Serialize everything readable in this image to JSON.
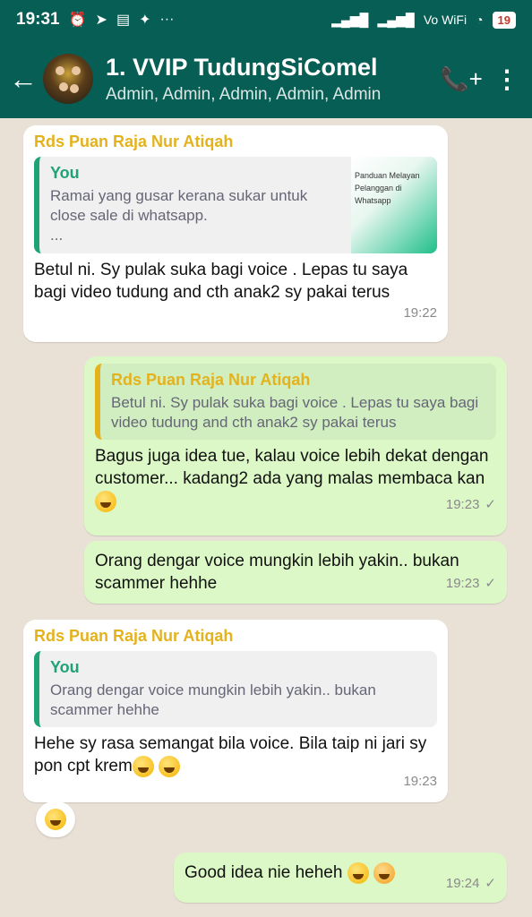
{
  "status": {
    "time": "19:31",
    "battery": "19",
    "net_label": "Vo WiFi",
    "left_icons": [
      "alarm-icon",
      "telegram-icon",
      "news-icon",
      "twitter-icon"
    ],
    "more": "···"
  },
  "header": {
    "back_icon": "←",
    "title": "1. VVIP TudungSiComel",
    "subtitle": "Admin, Admin, Admin, Admin, Admin",
    "call_icon": "📞+",
    "menu_icon": "⋮"
  },
  "messages": [
    {
      "sender": "Rds Puan Raja Nur Atiqah",
      "quote_name": "You",
      "quote_text": "Ramai yang gusar kerana sukar untuk close sale di whatsapp.",
      "quote_more": "...",
      "thumb_text": "Panduan Melayan Pelanggan di Whatsapp",
      "text": "Betul ni. Sy pulak suka bagi voice . Lepas tu saya bagi video tudung and cth anak2 sy pakai terus",
      "time": "19:22"
    },
    {
      "quote_name": "Rds Puan Raja Nur Atiqah",
      "quote_text": "Betul ni. Sy pulak suka bagi voice . Lepas tu saya bagi video tudung and cth anak2 sy pakai terus",
      "text": "Bagus juga idea tue, kalau voice lebih dekat dengan customer... kadang2 ada yang malas membaca kan",
      "time": "19:23"
    },
    {
      "text": "Orang dengar voice mungkin lebih yakin.. bukan scammer hehhe",
      "time": "19:23"
    },
    {
      "sender": "Rds Puan Raja Nur Atiqah",
      "quote_name": "You",
      "quote_text": "Orang dengar voice mungkin lebih yakin.. bukan scammer hehhe",
      "text": "Hehe sy rasa semangat bila voice. Bila taip ni jari sy pon cpt krem",
      "time": "19:23"
    },
    {
      "text": "Good idea nie heheh",
      "time": "19:24"
    }
  ],
  "tick": "✓",
  "reaction": "😂"
}
